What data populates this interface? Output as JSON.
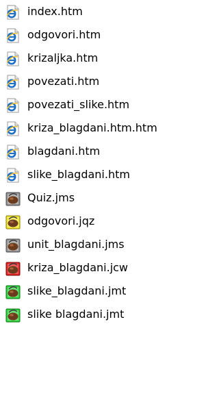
{
  "files": [
    {
      "name": "index.htm",
      "icon": "ie-document-icon"
    },
    {
      "name": "odgovori.htm",
      "icon": "ie-document-icon"
    },
    {
      "name": "krizaljka.htm",
      "icon": "ie-document-icon"
    },
    {
      "name": "povezati.htm",
      "icon": "ie-document-icon"
    },
    {
      "name": "povezati_slike.htm",
      "icon": "ie-document-icon"
    },
    {
      "name": "kriza_blagdani.htm.htm",
      "icon": "ie-document-icon"
    },
    {
      "name": "blagdani.htm",
      "icon": "ie-document-icon"
    },
    {
      "name": "slike_blagdani.htm",
      "icon": "ie-document-icon"
    },
    {
      "name": "Quiz.jms",
      "icon": "hotpotatoes-gray-icon"
    },
    {
      "name": "odgovori.jqz",
      "icon": "hotpotatoes-yellow-icon"
    },
    {
      "name": "unit_blagdani.jms",
      "icon": "hotpotatoes-gray-icon"
    },
    {
      "name": "kriza_blagdani.jcw",
      "icon": "hotpotatoes-red-icon"
    },
    {
      "name": "slike_blagdani.jmt",
      "icon": "hotpotatoes-green-icon"
    },
    {
      "name": "slike blagdani.jmt",
      "icon": "hotpotatoes-green-icon"
    }
  ],
  "colors": {
    "ie_blue": "#1f6fc5",
    "ie_gold": "#f3c43b",
    "pot_gray": "#8c8c8c",
    "pot_yellow": "#f2e32a",
    "pot_red": "#e02020",
    "pot_green": "#2bcf3a",
    "pot_brown": "#6a3b1c"
  }
}
